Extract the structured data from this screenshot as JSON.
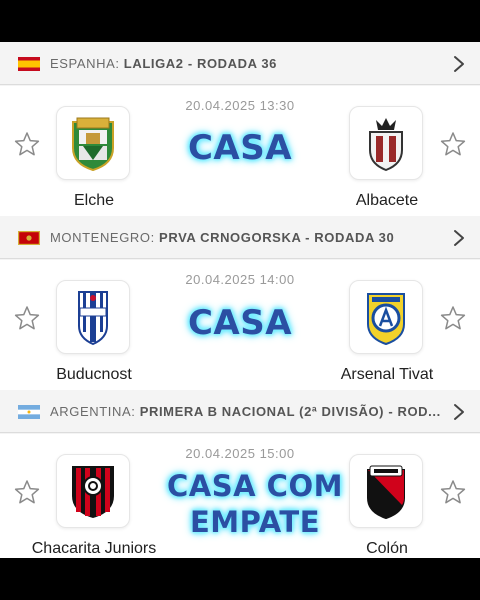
{
  "colors": {
    "overlay_text": "#2b4fa3",
    "overlay_glow": "#7df3ff"
  },
  "matches": [
    {
      "country": "ESPANHA:",
      "competition": "LALIGA2 - RODADA 36",
      "flag": "spain-flag-icon",
      "datetime": "20.04.2025 13:30",
      "home": "Elche",
      "away": "Albacete",
      "overlay": "CASA"
    },
    {
      "country": "MONTENEGRO:",
      "competition": "PRVA CRNOGORSKA - RODADA 30",
      "flag": "montenegro-flag-icon",
      "datetime": "20.04.2025 14:00",
      "home": "Buducnost",
      "away": "Arsenal Tivat",
      "overlay": "CASA"
    },
    {
      "country": "ARGENTINA:",
      "competition": "PRIMERA B NACIONAL (2ª DIVISÃO) - ROD...",
      "flag": "argentina-flag-icon",
      "datetime": "20.04.2025 15:00",
      "home": "Chacarita Juniors",
      "away": "Colón",
      "overlay_line1": "CASA COM",
      "overlay_line2": "EMPATE"
    }
  ]
}
